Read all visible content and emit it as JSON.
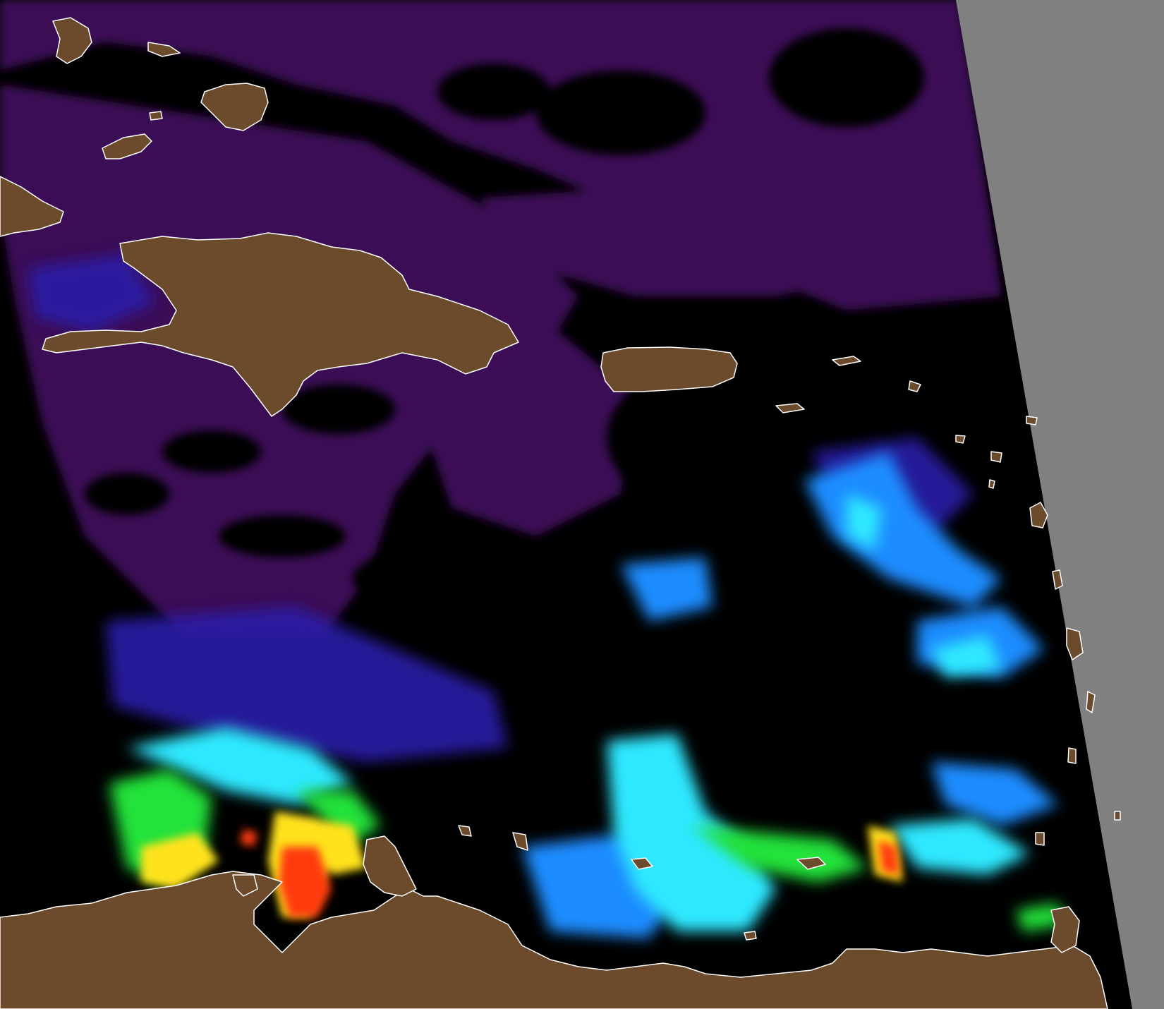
{
  "map": {
    "colors": {
      "background_no_data": "#000000",
      "outside_swath": "#808080",
      "land": "#6b4b2b",
      "coastline": "#ffffff",
      "low_chlorophyll": "#3a0a55",
      "mid_low": "#2a1aa8",
      "mid": "#1e8cff",
      "mid_high": "#2ee8ff",
      "high": "#22e23a",
      "very_high": "#ffe21a",
      "extreme": "#ff3a0a"
    }
  }
}
